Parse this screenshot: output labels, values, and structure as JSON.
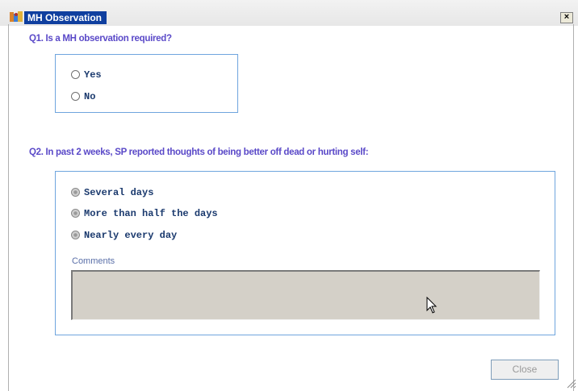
{
  "window": {
    "title": "MH Observation",
    "close_glyph": "×",
    "app_icon": "app-icon",
    "close_icon": "close-icon"
  },
  "q1": {
    "text": "Q1. Is a MH observation required?",
    "options": [
      "Yes",
      "No"
    ]
  },
  "q2": {
    "text": "Q2. In past 2 weeks, SP reported thoughts of being better off dead or hurting self:",
    "options": [
      "Several days",
      "More than half the days",
      "Nearly every day"
    ]
  },
  "comments": {
    "label": "Comments",
    "value": ""
  },
  "footer": {
    "close_label": "Close"
  },
  "colors": {
    "title_bg": "#0f3f9f",
    "question_text": "#5a49c8",
    "group_border": "#6fa5de",
    "option_text": "#1b3a6e",
    "comments_bg": "#d4d0c8"
  }
}
